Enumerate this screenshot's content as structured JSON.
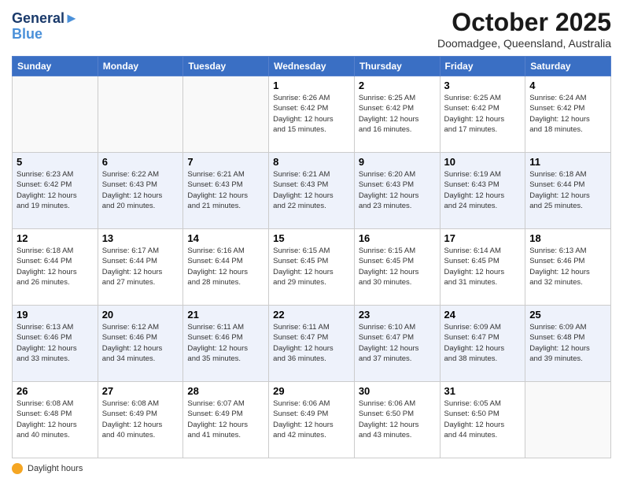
{
  "header": {
    "logo_line1": "General",
    "logo_line2": "Blue",
    "month": "October 2025",
    "location": "Doomadgee, Queensland, Australia"
  },
  "days_of_week": [
    "Sunday",
    "Monday",
    "Tuesday",
    "Wednesday",
    "Thursday",
    "Friday",
    "Saturday"
  ],
  "weeks": [
    [
      {
        "num": "",
        "detail": ""
      },
      {
        "num": "",
        "detail": ""
      },
      {
        "num": "",
        "detail": ""
      },
      {
        "num": "1",
        "detail": "Sunrise: 6:26 AM\nSunset: 6:42 PM\nDaylight: 12 hours\nand 15 minutes."
      },
      {
        "num": "2",
        "detail": "Sunrise: 6:25 AM\nSunset: 6:42 PM\nDaylight: 12 hours\nand 16 minutes."
      },
      {
        "num": "3",
        "detail": "Sunrise: 6:25 AM\nSunset: 6:42 PM\nDaylight: 12 hours\nand 17 minutes."
      },
      {
        "num": "4",
        "detail": "Sunrise: 6:24 AM\nSunset: 6:42 PM\nDaylight: 12 hours\nand 18 minutes."
      }
    ],
    [
      {
        "num": "5",
        "detail": "Sunrise: 6:23 AM\nSunset: 6:42 PM\nDaylight: 12 hours\nand 19 minutes."
      },
      {
        "num": "6",
        "detail": "Sunrise: 6:22 AM\nSunset: 6:43 PM\nDaylight: 12 hours\nand 20 minutes."
      },
      {
        "num": "7",
        "detail": "Sunrise: 6:21 AM\nSunset: 6:43 PM\nDaylight: 12 hours\nand 21 minutes."
      },
      {
        "num": "8",
        "detail": "Sunrise: 6:21 AM\nSunset: 6:43 PM\nDaylight: 12 hours\nand 22 minutes."
      },
      {
        "num": "9",
        "detail": "Sunrise: 6:20 AM\nSunset: 6:43 PM\nDaylight: 12 hours\nand 23 minutes."
      },
      {
        "num": "10",
        "detail": "Sunrise: 6:19 AM\nSunset: 6:43 PM\nDaylight: 12 hours\nand 24 minutes."
      },
      {
        "num": "11",
        "detail": "Sunrise: 6:18 AM\nSunset: 6:44 PM\nDaylight: 12 hours\nand 25 minutes."
      }
    ],
    [
      {
        "num": "12",
        "detail": "Sunrise: 6:18 AM\nSunset: 6:44 PM\nDaylight: 12 hours\nand 26 minutes."
      },
      {
        "num": "13",
        "detail": "Sunrise: 6:17 AM\nSunset: 6:44 PM\nDaylight: 12 hours\nand 27 minutes."
      },
      {
        "num": "14",
        "detail": "Sunrise: 6:16 AM\nSunset: 6:44 PM\nDaylight: 12 hours\nand 28 minutes."
      },
      {
        "num": "15",
        "detail": "Sunrise: 6:15 AM\nSunset: 6:45 PM\nDaylight: 12 hours\nand 29 minutes."
      },
      {
        "num": "16",
        "detail": "Sunrise: 6:15 AM\nSunset: 6:45 PM\nDaylight: 12 hours\nand 30 minutes."
      },
      {
        "num": "17",
        "detail": "Sunrise: 6:14 AM\nSunset: 6:45 PM\nDaylight: 12 hours\nand 31 minutes."
      },
      {
        "num": "18",
        "detail": "Sunrise: 6:13 AM\nSunset: 6:46 PM\nDaylight: 12 hours\nand 32 minutes."
      }
    ],
    [
      {
        "num": "19",
        "detail": "Sunrise: 6:13 AM\nSunset: 6:46 PM\nDaylight: 12 hours\nand 33 minutes."
      },
      {
        "num": "20",
        "detail": "Sunrise: 6:12 AM\nSunset: 6:46 PM\nDaylight: 12 hours\nand 34 minutes."
      },
      {
        "num": "21",
        "detail": "Sunrise: 6:11 AM\nSunset: 6:46 PM\nDaylight: 12 hours\nand 35 minutes."
      },
      {
        "num": "22",
        "detail": "Sunrise: 6:11 AM\nSunset: 6:47 PM\nDaylight: 12 hours\nand 36 minutes."
      },
      {
        "num": "23",
        "detail": "Sunrise: 6:10 AM\nSunset: 6:47 PM\nDaylight: 12 hours\nand 37 minutes."
      },
      {
        "num": "24",
        "detail": "Sunrise: 6:09 AM\nSunset: 6:47 PM\nDaylight: 12 hours\nand 38 minutes."
      },
      {
        "num": "25",
        "detail": "Sunrise: 6:09 AM\nSunset: 6:48 PM\nDaylight: 12 hours\nand 39 minutes."
      }
    ],
    [
      {
        "num": "26",
        "detail": "Sunrise: 6:08 AM\nSunset: 6:48 PM\nDaylight: 12 hours\nand 40 minutes."
      },
      {
        "num": "27",
        "detail": "Sunrise: 6:08 AM\nSunset: 6:49 PM\nDaylight: 12 hours\nand 40 minutes."
      },
      {
        "num": "28",
        "detail": "Sunrise: 6:07 AM\nSunset: 6:49 PM\nDaylight: 12 hours\nand 41 minutes."
      },
      {
        "num": "29",
        "detail": "Sunrise: 6:06 AM\nSunset: 6:49 PM\nDaylight: 12 hours\nand 42 minutes."
      },
      {
        "num": "30",
        "detail": "Sunrise: 6:06 AM\nSunset: 6:50 PM\nDaylight: 12 hours\nand 43 minutes."
      },
      {
        "num": "31",
        "detail": "Sunrise: 6:05 AM\nSunset: 6:50 PM\nDaylight: 12 hours\nand 44 minutes."
      },
      {
        "num": "",
        "detail": ""
      }
    ]
  ],
  "footer": {
    "daylight_label": "Daylight hours"
  }
}
